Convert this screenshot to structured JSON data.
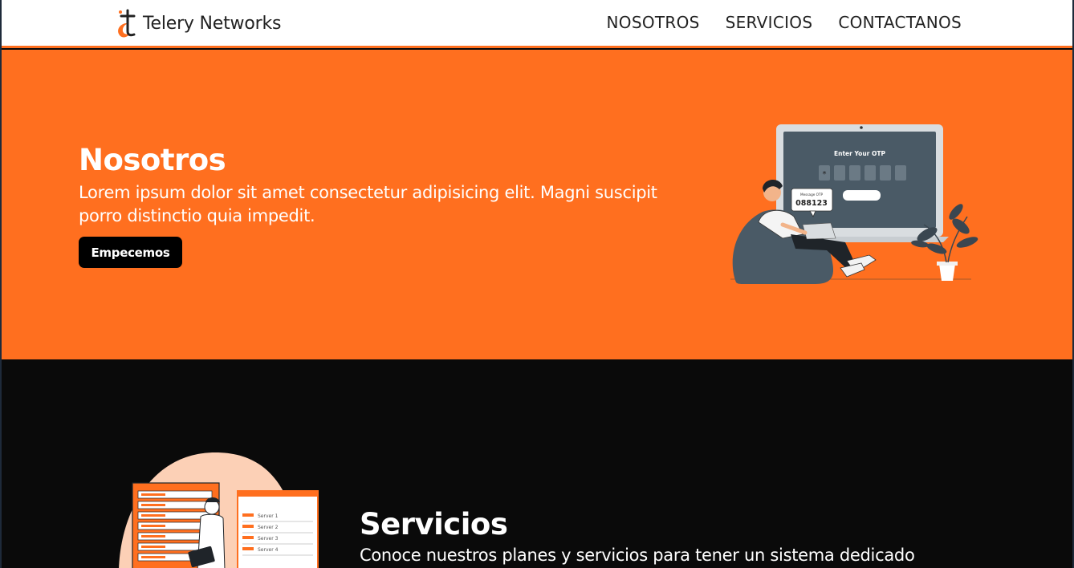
{
  "navbar": {
    "brand_name": "Telery Networks",
    "logo_icon": "telery-logo-icon",
    "links": [
      {
        "label": "NOSOTROS"
      },
      {
        "label": "SERVICIOS"
      },
      {
        "label": "CONTACTANOS"
      }
    ]
  },
  "hero": {
    "title": "Nosotros",
    "text": "Lorem ipsum dolor sit amet consectetur adipisicing elit. Magni suscipit porro distinctio quia impedit.",
    "button_label": "Empecemos",
    "illustration": {
      "otp_prompt": "Enter Your OTP",
      "message_label": "Message OTP",
      "otp_code": "088123"
    }
  },
  "services": {
    "title": "Servicios",
    "text": "Conoce nuestros planes y servicios para tener un sistema dedicado",
    "illustration": {
      "server_items": [
        "Server 1",
        "Server 2",
        "Server 3",
        "Server 4"
      ]
    }
  },
  "colors": {
    "accent": "#ff6f1f",
    "dark": "#0a0a0a",
    "slate": "#4a5a66"
  }
}
